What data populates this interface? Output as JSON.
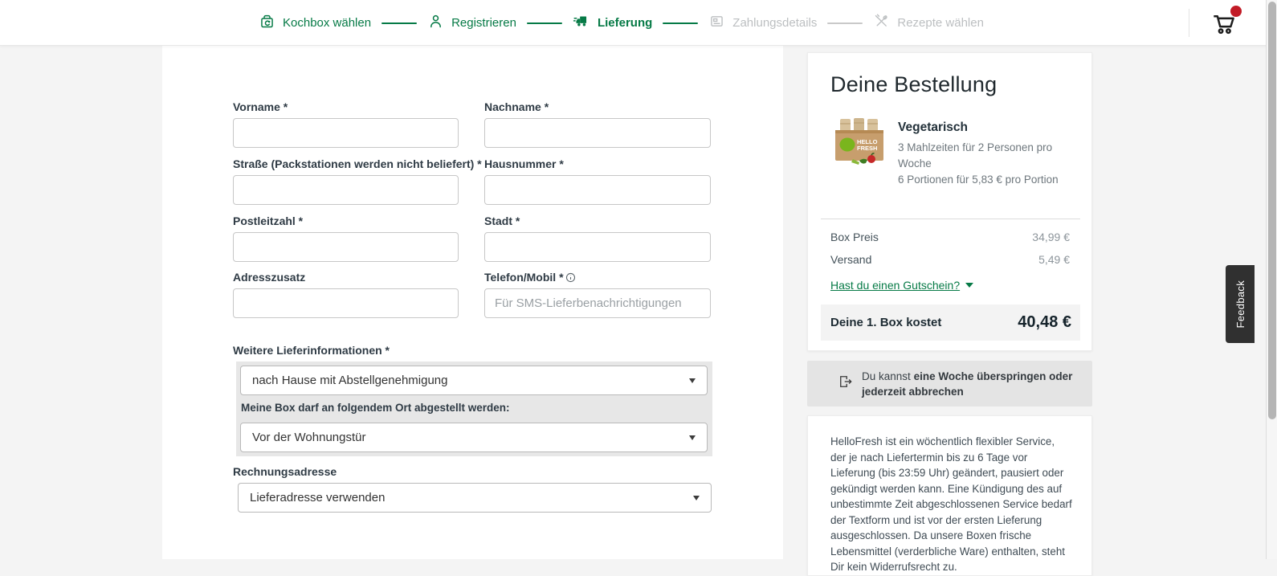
{
  "colors": {
    "accent_green": "#067a46",
    "badge_red": "#c21b26",
    "text_dark": "#2f3b45",
    "muted_gray": "#bcbfc1",
    "panel_gray": "#e7e7e7"
  },
  "header": {
    "steps": [
      {
        "label": "Kochbox wählen",
        "state": "done"
      },
      {
        "label": "Registrieren",
        "state": "done"
      },
      {
        "label": "Lieferung",
        "state": "active"
      },
      {
        "label": "Zahlungsdetails",
        "state": "upcoming"
      },
      {
        "label": "Rezepte wählen",
        "state": "upcoming"
      }
    ]
  },
  "form": {
    "vorname_label": "Vorname *",
    "nachname_label": "Nachname *",
    "strasse_label": "Straße (Packstationen werden nicht beliefert) *",
    "hausnummer_label": "Hausnummer *",
    "plz_label": "Postleitzahl *",
    "stadt_label": "Stadt *",
    "adresszusatz_label": "Adresszusatz",
    "telefon_label": "Telefon/Mobil *",
    "telefon_placeholder": "Für SMS-Lieferbenachrichtigungen",
    "lieferinfo_label": "Weitere Lieferinformationen *",
    "lieferinfo_value": "nach Hause mit Abstellgenehmigung",
    "abstellort_label": "Meine Box darf an folgendem Ort abgestellt werden:",
    "abstellort_value": "Vor der Wohnungstür",
    "rechnungsadresse_label": "Rechnungsadresse",
    "rechnungsadresse_value": "Lieferadresse verwenden"
  },
  "order": {
    "title": "Deine Bestellung",
    "product_name": "Vegetarisch",
    "product_desc1": "3 Mahlzeiten für 2 Personen pro Woche",
    "product_desc2": "6 Portionen für 5,83 € pro Portion",
    "box_logo_line1": "HELLO",
    "box_logo_line2": "FRESH",
    "box_preis_label": "Box Preis",
    "box_preis_value": "34,99 €",
    "versand_label": "Versand",
    "versand_value": "5,49 €",
    "gutschein_link": "Hast du einen Gutschein?",
    "total_label": "Deine 1. Box kostet",
    "total_value": "40,48 €"
  },
  "skip_notice": {
    "regular": "Du kannst",
    "bold": "eine Woche überspringen oder jederzeit abbrechen"
  },
  "legal_text": "HelloFresh ist ein wöchentlich flexibler Service, der je nach Liefertermin bis zu 6 Tage vor Lieferung (bis 23:59 Uhr) geändert, pausiert oder gekündigt werden kann. Eine Kündigung des auf unbestimmte Zeit abgeschlossenen Service bedarf der Textform und ist vor der ersten Lieferung ausgeschlossen. Da unsere Boxen frische Lebensmittel (verderbliche Ware) enthalten, steht Dir kein Widerrufsrecht zu.",
  "feedback_label": "Feedback"
}
